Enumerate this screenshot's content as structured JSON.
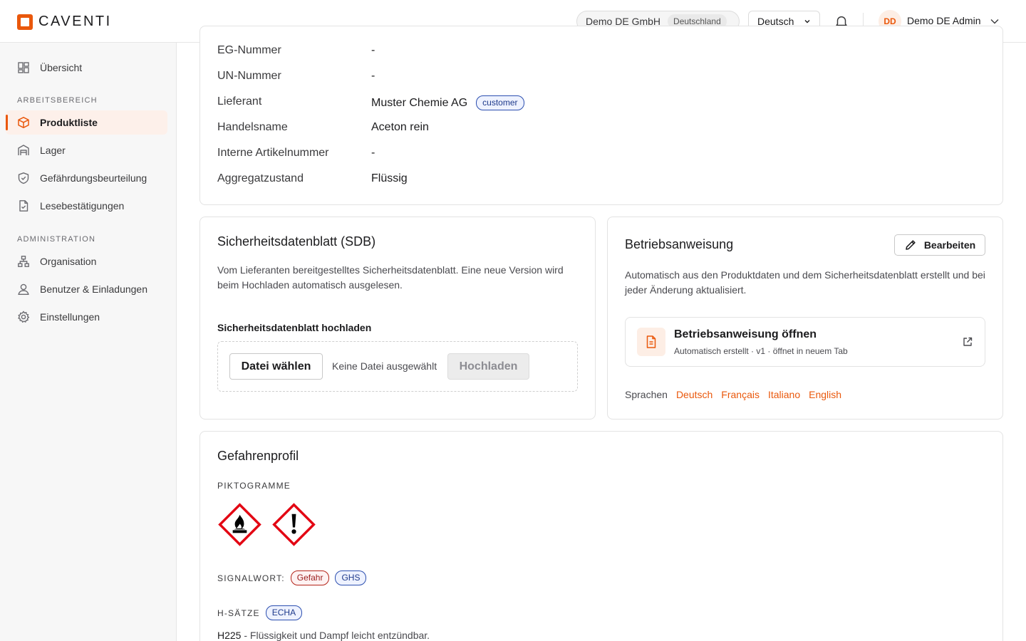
{
  "brand": {
    "name": "CAVENTI",
    "accent": "#ea580c"
  },
  "header": {
    "org_name": "Demo DE GmbH",
    "org_country": "Deutschland",
    "language": "Deutsch",
    "avatar_initials": "DD",
    "user_name": "Demo DE Admin"
  },
  "sidebar": {
    "overview": "Übersicht",
    "section_work": "ARBEITSBEREICH",
    "items_work": [
      "Produktliste",
      "Lager",
      "Gefährdungsbeurteilung",
      "Lesebestätigungen"
    ],
    "section_admin": "ADMINISTRATION",
    "items_admin": [
      "Organisation",
      "Benutzer & Einladungen",
      "Einstellungen"
    ]
  },
  "details": [
    {
      "label": "EG-Nummer",
      "value": "-"
    },
    {
      "label": "UN-Nummer",
      "value": "-"
    },
    {
      "label": "Lieferant",
      "value": "Muster Chemie AG",
      "badge": "customer"
    },
    {
      "label": "Handelsname",
      "value": "Aceton rein"
    },
    {
      "label": "Interne Artikelnummer",
      "value": "-"
    },
    {
      "label": "Aggregatzustand",
      "value": "Flüssig"
    }
  ],
  "sdb": {
    "title": "Sicherheitsdatenblatt (SDB)",
    "description": "Vom Lieferanten bereitgestelltes Sicherheitsdatenblatt. Eine neue Version wird beim Hochladen automatisch ausgelesen.",
    "upload_label": "Sicherheitsdatenblatt hochladen",
    "choose_file": "Datei wählen",
    "no_file": "Keine Datei ausgewählt",
    "upload_button": "Hochladen"
  },
  "ba": {
    "title": "Betriebsanweisung",
    "edit_button": "Bearbeiten",
    "description": "Automatisch aus den Produktdaten und dem Sicherheitsdatenblatt erstellt und bei jeder Änderung aktualisiert.",
    "link_title": "Betriebsanweisung öffnen",
    "link_sub": "Automatisch erstellt · v1 · öffnet in neuem Tab",
    "languages_label": "Sprachen",
    "languages": [
      "Deutsch",
      "Français",
      "Italiano",
      "English"
    ]
  },
  "hazard": {
    "title": "Gefahrenprofil",
    "pictograms_label": "PIKTOGRAMME",
    "pictograms": [
      "flame-icon",
      "exclamation-mark-icon"
    ],
    "signal_label": "SIGNALWORT:",
    "signal_word": "Gefahr",
    "signal_source": "GHS",
    "h_label": "H-SÄTZE",
    "h_source": "ECHA",
    "h_code": "H225",
    "h_text": "- Flüssigkeit und Dampf leicht entzündbar."
  }
}
